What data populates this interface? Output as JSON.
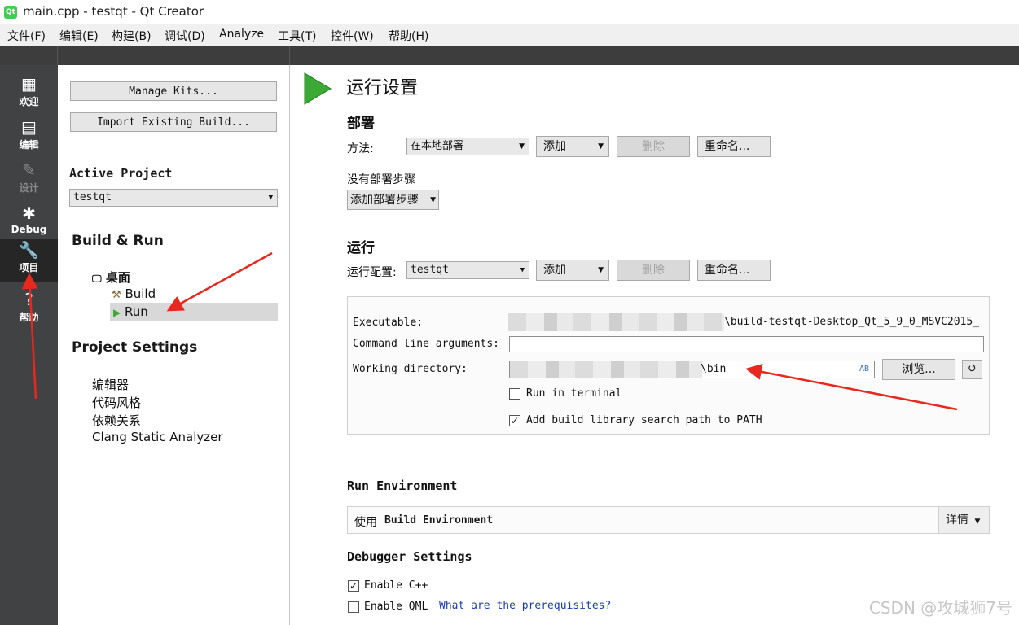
{
  "window": {
    "title": "main.cpp - testqt - Qt Creator",
    "app_icon": "qt-logo"
  },
  "menu": [
    "文件(F)",
    "编辑(E)",
    "构建(B)",
    "调试(D)",
    "Analyze",
    "工具(T)",
    "控件(W)",
    "帮助(H)"
  ],
  "modes": [
    {
      "label": "欢迎",
      "icon": "grid-icon"
    },
    {
      "label": "编辑",
      "icon": "document-icon"
    },
    {
      "label": "设计",
      "icon": "pencil-icon"
    },
    {
      "label": "Debug",
      "icon": "bug-icon"
    },
    {
      "label": "项目",
      "icon": "wrench-icon"
    },
    {
      "label": "帮助",
      "icon": "question-icon"
    }
  ],
  "left": {
    "manage_kits": "Manage Kits...",
    "import_build": "Import Existing Build...",
    "active_project_label": "Active Project",
    "active_project_value": "testqt",
    "build_run_label": "Build & Run",
    "kit_name": "桌面",
    "build_item": "Build",
    "run_item": "Run",
    "project_settings_label": "Project Settings",
    "settings_items": [
      "编辑器",
      "代码风格",
      "依赖关系",
      "Clang Static Analyzer"
    ]
  },
  "run": {
    "page_title": "运行设置",
    "deploy_header": "部署",
    "method_label": "方法:",
    "method_value": "在本地部署",
    "add_label": "添加",
    "remove_label": "删除",
    "rename_label": "重命名...",
    "no_deploy_steps": "没有部署步骤",
    "add_deploy_step": "添加部署步骤",
    "run_header": "运行",
    "run_config_label": "运行配置:",
    "run_config_value": "testqt",
    "executable_label": "Executable:",
    "executable_value": "\\build-testqt-Desktop_Qt_5_9_0_MSVC2015_",
    "args_label": "Command line arguments:",
    "args_value": "",
    "workdir_label": "Working directory:",
    "workdir_value": "\\bin",
    "browse_label": "浏览...",
    "run_in_terminal": "Run in terminal",
    "run_in_terminal_checked": false,
    "add_lib_path": "Add build library search path to PATH",
    "add_lib_path_checked": true,
    "run_env_header": "Run Environment",
    "use_env_prefix": "使用",
    "use_env_value": "Build Environment",
    "details_label": "详情",
    "debugger_header": "Debugger Settings",
    "enable_cpp": "Enable C++",
    "enable_cpp_checked": true,
    "enable_qml": "Enable QML",
    "enable_qml_checked": false,
    "prereq_link": "What are the prerequisites?"
  },
  "watermark": "CSDN @攻城狮7号",
  "colors": {
    "modebar": "#404244",
    "active_mode": "#262626",
    "run_triangle": "#3aaa35",
    "annotation_arrow": "#e8281e",
    "link": "#1a3fb0"
  }
}
